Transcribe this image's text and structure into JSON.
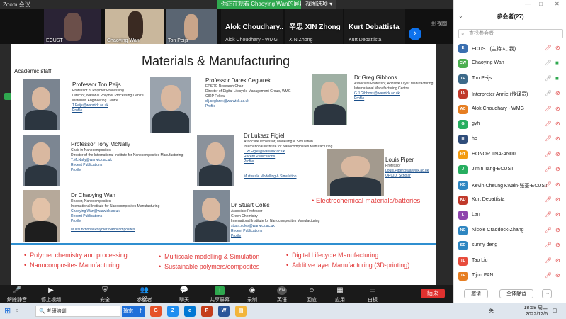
{
  "window": {
    "app_title": "Zoom 会议"
  },
  "share_banner": "你正在观看 Chaoying Wan的屏幕",
  "view_options": "视图选项",
  "view_button": "视图",
  "video_strip": {
    "tiles": [
      {
        "name": "ECUST"
      },
      {
        "name": "Chaoying Wan"
      },
      {
        "name": "Ton Peijs"
      }
    ],
    "big_tiles": [
      {
        "name": "Alok Choudhary...",
        "sub": "Alok Choudhary - WMG"
      },
      {
        "name": "辛忠 XIN Zhong",
        "sub": "XIN Zhong"
      },
      {
        "name": "Kurt Debattista",
        "sub": "Kurt Debattista"
      }
    ]
  },
  "slide": {
    "title": "Materials & Manufacturing",
    "section": "Academic staff",
    "people": [
      {
        "name": "Professor Ton Peijs",
        "lines": [
          "Professor of Polymer Processing",
          "Director, National Polymer Processing Centre",
          "Materials Engineering Centre"
        ],
        "links": [
          "T.Peijs@warwick.ac.uk",
          "Profile"
        ]
      },
      {
        "name": "Professor Darek Ceglarek",
        "lines": [
          "EPSRC Research Chair",
          "Director of Digital Lifecycle Management Group, WMG",
          "CIRP Fellow"
        ],
        "links": [
          "d.j.ceglarek@warwick.ac.uk",
          "Profile"
        ]
      },
      {
        "name": "Dr Greg Gibbons",
        "lines": [
          "Associate Professor, Additive Layer Manufacturing",
          "International Manufacturing Centre"
        ],
        "links": [
          "G.J.Gibbons@warwick.ac.uk",
          "Profile"
        ]
      },
      {
        "name": "Professor Tony McNally",
        "lines": [
          "Chair in Nanocomposites;",
          "Director of the International Institute for Nanocomposites Manufacturing;"
        ],
        "links": [
          "T.McNally@warwick.ac.uk",
          "Recent Publications",
          "Profile"
        ]
      },
      {
        "name": "Dr Lukasz Figiel",
        "lines": [
          "Associate Professor, Modelling & Simulation",
          "International Institute for Nanocomposites Manufacturing"
        ],
        "links": [
          "L.W.Figiel@warwick.ac.uk",
          "Recent Publications",
          "Profile",
          "Multiscale Modelling & Simulation"
        ]
      },
      {
        "name": "Louis Piper",
        "lines": [
          "Professor"
        ],
        "links": [
          "Louis.Piper@warwick.ac.uk",
          "ORCID, Scholar"
        ]
      },
      {
        "name": "Dr Chaoying Wan",
        "lines": [
          "Reader, Nanocomposites",
          "International Institute for Nanocomposites Manufacturing"
        ],
        "links": [
          "Chaoying.Wan@warwick.ac.uk",
          "Recent Publications",
          "Profile",
          "Multifunctional Polymer Nanocomposites"
        ]
      },
      {
        "name": "Dr Stuart Coles",
        "lines": [
          "Associate Professor",
          "Green Chemistry",
          "International Institute for Nanocomposites Manufacturing"
        ],
        "links": [
          "stuart.coles@warwick.ac.uk",
          "Recent Publications",
          "Profile"
        ]
      }
    ],
    "topic_right": "Electrochemical materials/batteries",
    "bullets": [
      "Polymer chemistry and processing",
      "Nanocomposites Manufacturing",
      "Multiscale modelling & Simulation",
      "Sustainable polymers/composites",
      "Digital Lifecycle Manufacturing",
      "Additive layer Manufacturing (3D-printing)"
    ]
  },
  "toolbar": {
    "buttons": [
      {
        "label": "解除静音",
        "icon": "mic-muted-icon"
      },
      {
        "label": "停止视频",
        "icon": "video-camera-icon"
      },
      {
        "label": "安全",
        "icon": "shield-icon"
      },
      {
        "label": "参会者",
        "icon": "participants-icon",
        "count": "27"
      },
      {
        "label": "聊天",
        "icon": "chat-icon"
      },
      {
        "label": "共享屏幕",
        "icon": "share-screen-icon"
      },
      {
        "label": "录制",
        "icon": "record-icon"
      },
      {
        "label": "英语",
        "icon": "language-icon",
        "badge": "EN"
      },
      {
        "label": "回应",
        "icon": "reaction-icon"
      },
      {
        "label": "应用",
        "icon": "apps-icon"
      },
      {
        "label": "白板",
        "icon": "whiteboard-icon"
      }
    ],
    "end": "结束"
  },
  "participants": {
    "title": "参会者(27)",
    "search_placeholder": "查找参会者",
    "list": [
      {
        "initials": "E",
        "name": "ECUST (主持人, 我)",
        "color": "#3a6fb0",
        "mic": "muted",
        "cam": "off"
      },
      {
        "initials": "CW",
        "name": "Chaoying Wan",
        "color": "#4caf50",
        "mic": "on",
        "cam": "on"
      },
      {
        "initials": "TP",
        "name": "Ton Peijs",
        "color": "#3d6a8a",
        "mic": "on",
        "cam": "on"
      },
      {
        "initials": "IA",
        "name": "Interpreter Annie (传译员)",
        "color": "#c0392b",
        "mic": "on",
        "cam": "off"
      },
      {
        "initials": "AC",
        "name": "Alok Choudhary - WMG",
        "color": "#e67e22",
        "mic": "muted",
        "cam": "off"
      },
      {
        "initials": "G",
        "name": "gyh",
        "color": "#27ae60",
        "mic": "muted",
        "cam": "off"
      },
      {
        "initials": "H",
        "name": "hc",
        "color": "#2f4d7a",
        "mic": "muted",
        "cam": "off"
      },
      {
        "initials": "HT",
        "name": "HONOR TNA-AN00",
        "color": "#f39c12",
        "mic": "muted",
        "cam": "off"
      },
      {
        "initials": "J",
        "name": "Jimin Tang-ECUST",
        "color": "#27ae60",
        "mic": "muted",
        "cam": "off"
      },
      {
        "initials": "KC",
        "name": "Kevin Cheung Kwain-张荃-ECUST",
        "color": "#2e86c1",
        "mic": "muted",
        "cam": "off"
      },
      {
        "initials": "KD",
        "name": "Kurt Debattista",
        "color": "#c0392b",
        "mic": "muted",
        "cam": "off"
      },
      {
        "initials": "L",
        "name": "Lan",
        "color": "#8e44ad",
        "mic": "muted",
        "cam": "off"
      },
      {
        "initials": "NC",
        "name": "Nicole Craddock-Zhang",
        "color": "#2e86c1",
        "mic": "muted",
        "cam": "off"
      },
      {
        "initials": "SD",
        "name": "sunny deng",
        "color": "#2e86c1",
        "mic": "muted",
        "cam": "off"
      },
      {
        "initials": "TL",
        "name": "Tao Liu",
        "color": "#e74c3c",
        "mic": "muted",
        "cam": "off"
      },
      {
        "initials": "TF",
        "name": "Tijun FAN",
        "color": "#e67e22",
        "mic": "muted",
        "cam": "off"
      }
    ],
    "invite": "邀请",
    "mute_all": "全体静音",
    "more": "···"
  },
  "taskbar": {
    "search_text": "考研培训",
    "search_button": "搜索一下",
    "time": "18:58 周二",
    "date": "2022/12/6",
    "lang": "英"
  }
}
